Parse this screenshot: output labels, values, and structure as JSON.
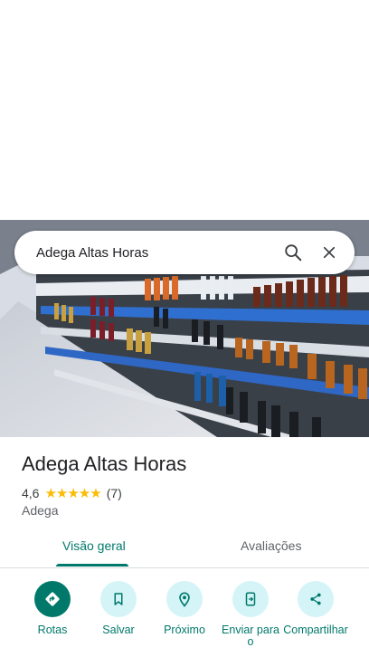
{
  "search": {
    "query": "Adega Altas Horas"
  },
  "place": {
    "name": "Adega Altas Horas",
    "rating": "4,6",
    "stars": "★★★★★",
    "review_count": "(7)",
    "category": "Adega"
  },
  "tabs": [
    {
      "label": "Visão geral",
      "active": true
    },
    {
      "label": "Avaliações",
      "active": false
    }
  ],
  "actions": [
    {
      "label": "Rotas",
      "icon": "directions-icon"
    },
    {
      "label": "Salvar",
      "icon": "bookmark-icon"
    },
    {
      "label": "Próximo",
      "icon": "nearby-icon"
    },
    {
      "label": "Enviar para o",
      "icon": "send-to-phone-icon"
    },
    {
      "label": "Compartilhar",
      "icon": "share-icon"
    }
  ],
  "colors": {
    "accent": "#00796b",
    "action_bg": "#d4f4f7",
    "star": "#fbbc04"
  }
}
